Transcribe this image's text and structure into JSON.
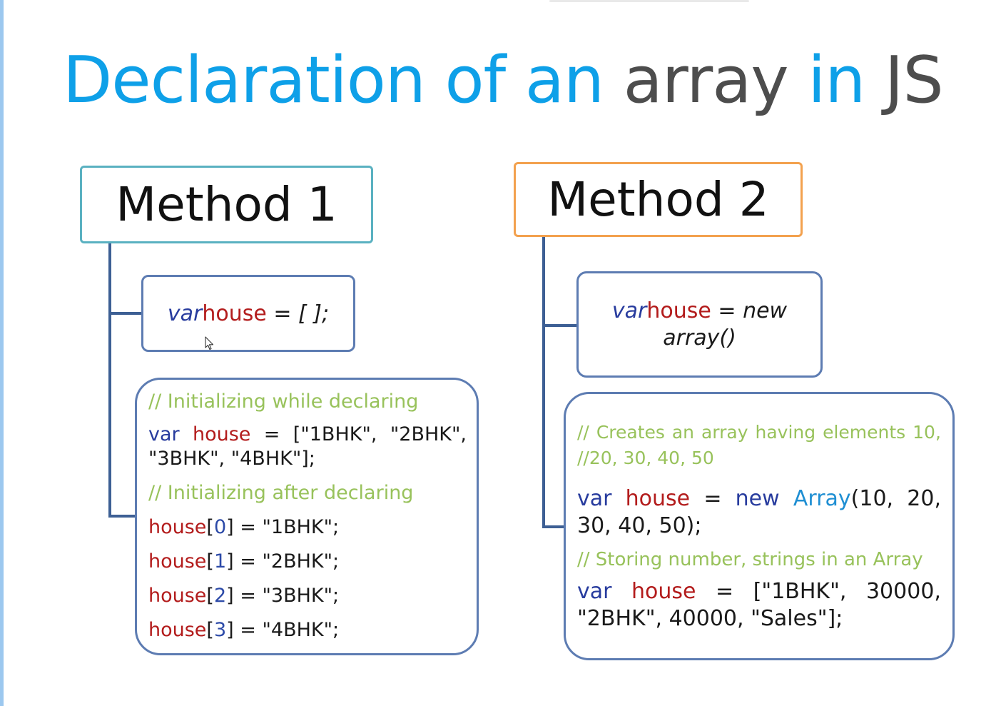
{
  "title": {
    "part1": "Declaration of an",
    "part2": "array",
    "part3": "in",
    "part4": "JS"
  },
  "method1": {
    "label": "Method 1",
    "decl": {
      "kw": "var",
      "name": "house",
      "rest": "= [ ];"
    },
    "init": {
      "comment1": "// Initializing while declaring",
      "line1": {
        "kw": "var",
        "name": "house",
        "eq": "=",
        "val": "[\"1BHK\",",
        "val2": "\"2BHK\","
      },
      "line2": "\"3BHK\", \"4BHK\"];",
      "comment2": "// Initializing after declaring",
      "assigns": [
        {
          "name": "house",
          "idx": "0",
          "value": "= \"1BHK\";"
        },
        {
          "name": "house",
          "idx": "1",
          "value": "= \"2BHK\";"
        },
        {
          "name": "house",
          "idx": "2",
          "value": "= \"3BHK\";"
        },
        {
          "name": "house",
          "idx": "3",
          "value": "= \"4BHK\";"
        }
      ]
    }
  },
  "method2": {
    "label": "Method 2",
    "decl": {
      "kw": "var",
      "name": "house",
      "rest": "= new",
      "line2": "array()"
    },
    "init": {
      "comment1a": [
        "//",
        "Creates",
        "an",
        "array",
        "having",
        "elements",
        "10,"
      ],
      "comment1b": "//20, 30, 40, 50",
      "line1": {
        "kw": "var",
        "name": "house",
        "eq": "=",
        "new": "new",
        "cls": "Array",
        "args": "(10,",
        "args2": "20,"
      },
      "line2": "30, 40, 50);",
      "comment2": "// Storing number, strings in an Array",
      "line3": {
        "kw": "var",
        "name": "house",
        "eq": "=",
        "val": "[\"1BHK\",",
        "val2": "30000,"
      },
      "line4": "\"2BHK\", 40000, \"Sales\"];"
    }
  },
  "colors": {
    "title_blue": "#0ea0e8",
    "title_grey": "#4d4d4d",
    "method1_border": "#5ab1c1",
    "method2_border": "#f3a14e",
    "connector": "#3d5f94",
    "keyword": "#283c9e",
    "identifier": "#b31c1c",
    "comment": "#98c25b",
    "class_name": "#1f8fd3"
  }
}
